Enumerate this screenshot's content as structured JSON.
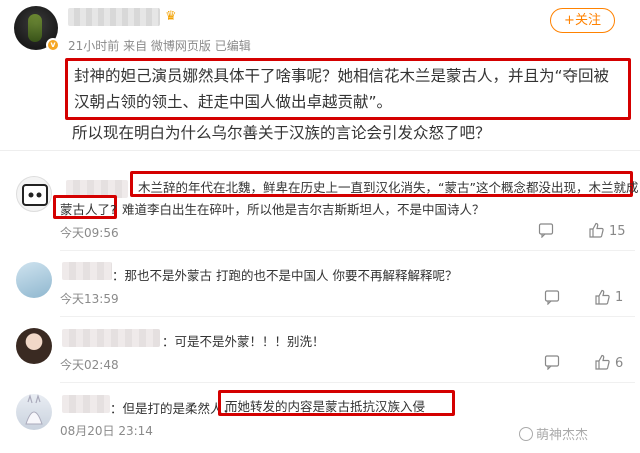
{
  "post": {
    "meta": "21小时前 来自 微博网页版 已编辑",
    "follow_label": "+关注",
    "highlight_text": "封神的妲己演员娜然具体干了啥事呢？她相信花木兰是蒙古人，并且为“夺回被汉朝占领的领土、赶走中国人做出卓越贡献”。",
    "plain_text": "所以现在明白为什么乌尔善关于汉族的言论会引发众怒了吧？"
  },
  "comments": [
    {
      "line1": "木兰辞的年代在北魏，鲜卑在历史上一直到汉化消失，“蒙古”这个概念都没出现，木兰就成",
      "line2_boxed": "蒙古人了?",
      "line2_rest": "难道李白出生在碎叶，所以他是吉尔吉斯斯坦人，不是中国诗人？",
      "time": "今天09:56",
      "likes": "15"
    },
    {
      "text": "：那也不是外蒙古 打跑的也不是中国人 你要不再解释解释呢？",
      "time": "今天13:59",
      "likes": "1"
    },
    {
      "text": "：可是不是外蒙！！！别洗！",
      "time": "今天02:48",
      "likes": "6"
    },
    {
      "text_prefix": "：但是打的是柔然人，",
      "text_boxed": "而她转发的内容是蒙古抵抗汉族入侵",
      "time": "08月20日 23:14"
    }
  ],
  "watermark": "萌神杰杰",
  "icons": {
    "crown": "crown-icon",
    "verified": "verified-badge-icon",
    "reply": "comment-icon",
    "like": "thumb-up-icon",
    "share": "share-icon"
  }
}
